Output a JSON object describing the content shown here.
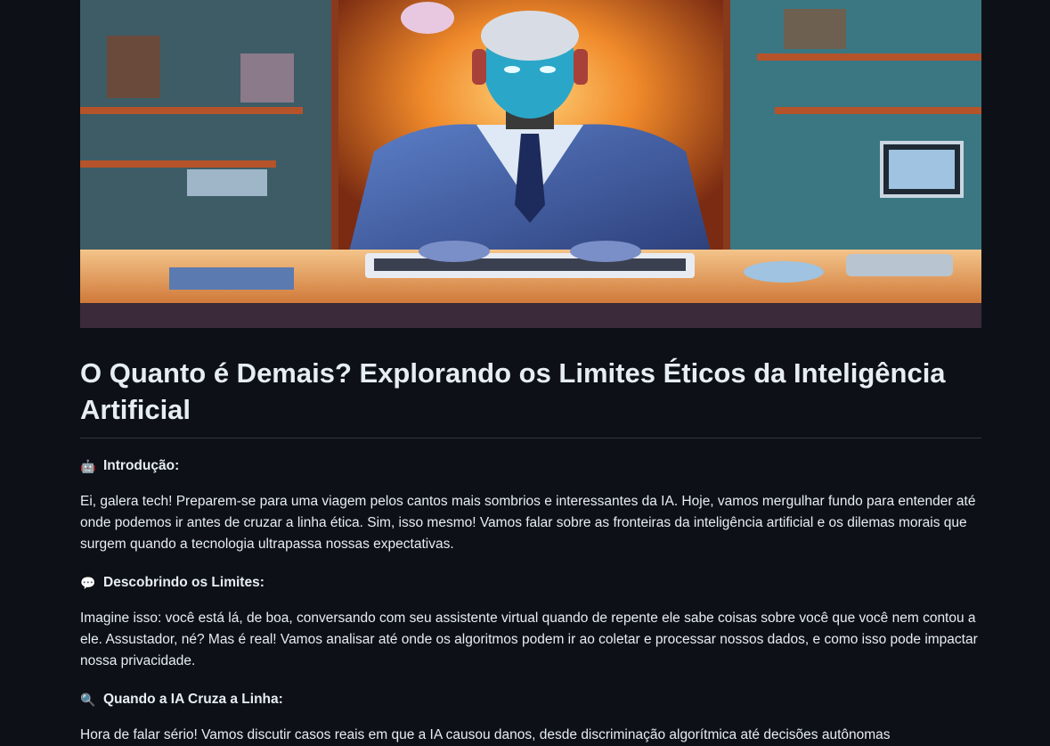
{
  "article": {
    "hero_image_alt": "robot-office-illustration",
    "title": "O Quanto é Demais? Explorando os Limites Éticos da Inteligência Artificial",
    "sections": [
      {
        "icon": "robot-icon",
        "icon_glyph": "🤖",
        "heading": "Introdução:",
        "text": "Ei, galera tech! Preparem-se para uma viagem pelos cantos mais sombrios e interessantes da IA. Hoje, vamos mergulhar fundo para entender até onde podemos ir antes de cruzar a linha ética. Sim, isso mesmo! Vamos falar sobre as fronteiras da inteligência artificial e os dilemas morais que surgem quando a tecnologia ultrapassa nossas expectativas."
      },
      {
        "icon": "speech-bubble-icon",
        "icon_glyph": "💬",
        "heading": "Descobrindo os Limites:",
        "text": "Imagine isso: você está lá, de boa, conversando com seu assistente virtual quando de repente ele sabe coisas sobre você que você nem contou a ele. Assustador, né? Mas é real! Vamos analisar até onde os algoritmos podem ir ao coletar e processar nossos dados, e como isso pode impactar nossa privacidade."
      },
      {
        "icon": "magnifier-icon",
        "icon_glyph": "🔍",
        "heading": "Quando a IA Cruza a Linha:",
        "text": "Hora de falar sério! Vamos discutir casos reais em que a IA causou danos, desde discriminação algorítmica até decisões autônomas"
      }
    ]
  }
}
